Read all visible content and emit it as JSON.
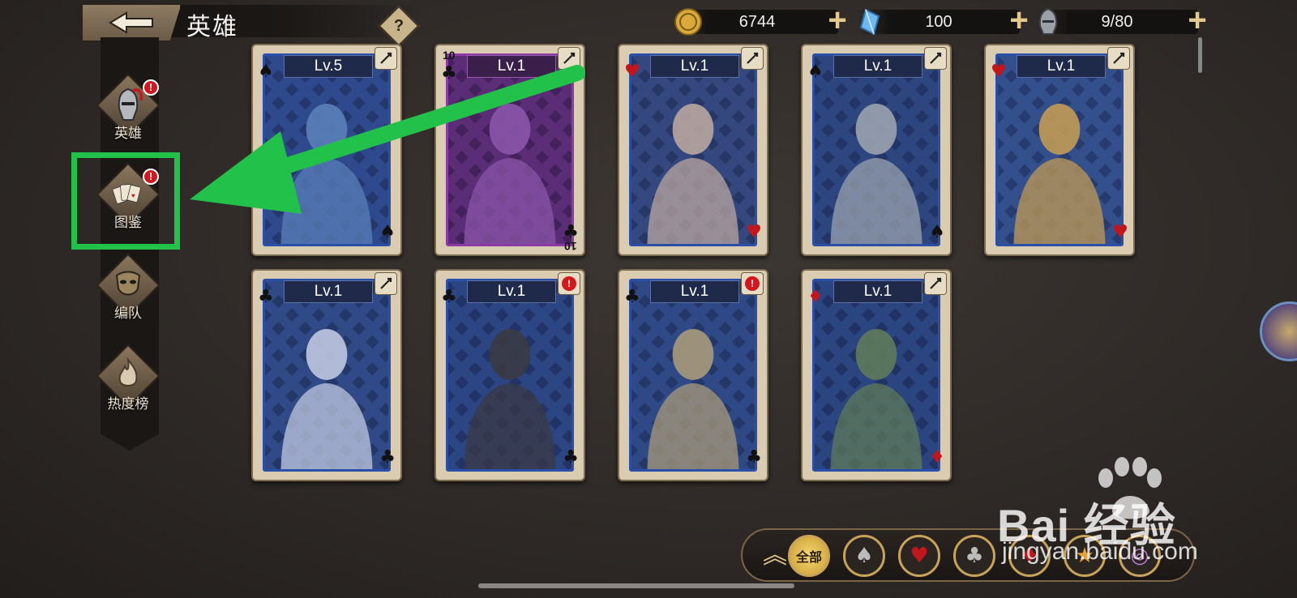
{
  "header": {
    "title": "英雄",
    "help_label": "?",
    "resources": [
      {
        "icon": "gold-coin-icon",
        "value": "6744"
      },
      {
        "icon": "diamond-gem-icon",
        "value": "100"
      },
      {
        "icon": "knight-helmet-icon",
        "value": "9/80"
      }
    ],
    "plus_label": "+"
  },
  "sidebar": {
    "items": [
      {
        "label": "英雄",
        "icon": "knight-helmet-icon",
        "badge": "!"
      },
      {
        "label": "图鉴",
        "icon": "playing-cards-icon",
        "badge": "!"
      },
      {
        "label": "编队",
        "icon": "mask-icon",
        "badge": ""
      },
      {
        "label": "热度榜",
        "icon": "flame-icon",
        "badge": ""
      }
    ]
  },
  "cards": [
    {
      "level": "Lv.5",
      "suit": "♠",
      "rank": "",
      "frame": "blue",
      "class_icon": "staff-icon"
    },
    {
      "level": "Lv.1",
      "suit": "♣",
      "rank": "10",
      "frame": "purple",
      "class_icon": "swirl-icon"
    },
    {
      "level": "Lv.1",
      "suit": "♥",
      "rank": "",
      "frame": "blue",
      "class_icon": "swirl-icon"
    },
    {
      "level": "Lv.1",
      "suit": "♠",
      "rank": "",
      "frame": "blue",
      "class_icon": "sword-icon"
    },
    {
      "level": "Lv.1",
      "suit": "♥",
      "rank": "",
      "frame": "blue",
      "class_icon": "spear-icon"
    },
    {
      "level": "Lv.1",
      "suit": "♣",
      "rank": "",
      "frame": "blue",
      "class_icon": "hand-icon"
    },
    {
      "level": "Lv.1",
      "suit": "♣",
      "rank": "",
      "frame": "blue",
      "class_icon": "alert-icon"
    },
    {
      "level": "Lv.1",
      "suit": "♣",
      "rank": "",
      "frame": "blue",
      "class_icon": "alert-icon"
    },
    {
      "level": "Lv.1",
      "suit": "♦",
      "rank": "",
      "frame": "blue",
      "class_icon": "sword-icon"
    }
  ],
  "filter": {
    "up_label": "︽",
    "all_label": "全部",
    "suits": [
      "♠",
      "♥",
      "♣",
      "♦",
      "★",
      "◎"
    ]
  },
  "watermark": {
    "brand": "Bai  经验",
    "url": "jingyan.baidu.com"
  },
  "colors": {
    "highlight": "#22c14a",
    "accent_gold": "#e3c98c",
    "card_frame_blue": "#2a4fa8"
  }
}
